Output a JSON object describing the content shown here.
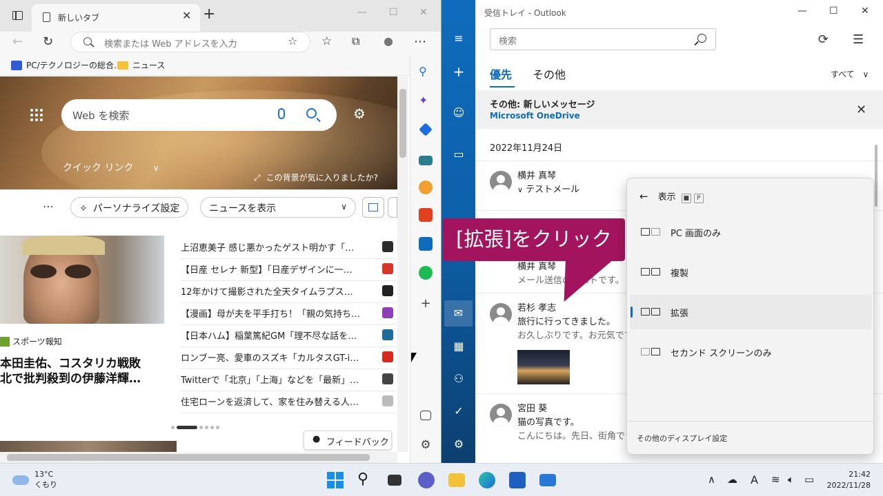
{
  "browser": {
    "tab_title": "新しいタブ",
    "address_placeholder": "検索または Web アドレスを入力",
    "bookmarks": [
      "PC/テクノロジーの総合…",
      "ニュース"
    ],
    "web_search_placeholder": "Web を検索",
    "quick_links": "クイック リンク",
    "bg_question": "この背景が気に入りましたか?",
    "personalize": "パーソナライズ設定",
    "news_dropdown": "ニュースを表示",
    "sports_source": "スポーツ報知",
    "headline": [
      "本田圭佑、コスタリカ戦敗",
      "北で批判殺到の伊藤洋輝…"
    ],
    "news_items": [
      {
        "title": "上沼恵美子 感じ悪かったゲスト明かす「…",
        "color": "#2c2c2c"
      },
      {
        "title": "【日産 セレナ 新型】「日産デザインに一…",
        "color": "#d9362b"
      },
      {
        "title": "12年かけて撮影された全天タイムラプス…",
        "color": "#222222"
      },
      {
        "title": "【漫画】母が夫を平手打ち！「親の気持ち…",
        "color": "#8e3fb8"
      },
      {
        "title": "【日本ハム】稲葉篤紀GM「理不尽な話を…",
        "color": "#1e6b9a"
      },
      {
        "title": "ロンブー亮、愛車のスズキ「カルタスGT-i…",
        "color": "#d52b1e"
      },
      {
        "title": "Twitterで「北京」「上海」などを「最新」…",
        "color": "#444444"
      },
      {
        "title": "住宅ローンを返済して、家を住み替える人…",
        "color": "#bbbbbb"
      }
    ],
    "feedback": "フィードバック"
  },
  "outlook": {
    "window_title": "受信トレイ - Outlook",
    "search_placeholder": "検索",
    "tab_focused": "優先",
    "tab_other": "その他",
    "filter": "すべて",
    "notice_title": "その他: 新しいメッセージ",
    "notice_sender": "Microsoft OneDrive",
    "date_header": "2022年11月24日",
    "mails": [
      {
        "from": "横井 真琴",
        "subject": "テストメール",
        "preview": ""
      },
      {
        "from": "横井 真琴",
        "subject": "",
        "preview": "メール送信のテストです。"
      },
      {
        "from": "若杉 孝志",
        "subject": "旅行に行ってきました。",
        "preview": "お久しぶりです。お元気です"
      },
      {
        "from": "宮田 葵",
        "subject": "猫の写真です。",
        "preview": "こんにちは。先日、街角で"
      }
    ]
  },
  "flyout": {
    "title": "表示",
    "key1": "■",
    "key2": "P",
    "options": [
      "PC 画面のみ",
      "複製",
      "拡張",
      "セカンド スクリーンのみ"
    ],
    "selected": "拡張",
    "footer": "その他のディスプレイ設定"
  },
  "callout": {
    "text": "[拡張]をクリック",
    "color": "#a3145e"
  },
  "taskbar": {
    "temperature": "13°C",
    "weather": "くもり",
    "ime": "A",
    "time": "21:42",
    "date": "2022/11/28"
  }
}
